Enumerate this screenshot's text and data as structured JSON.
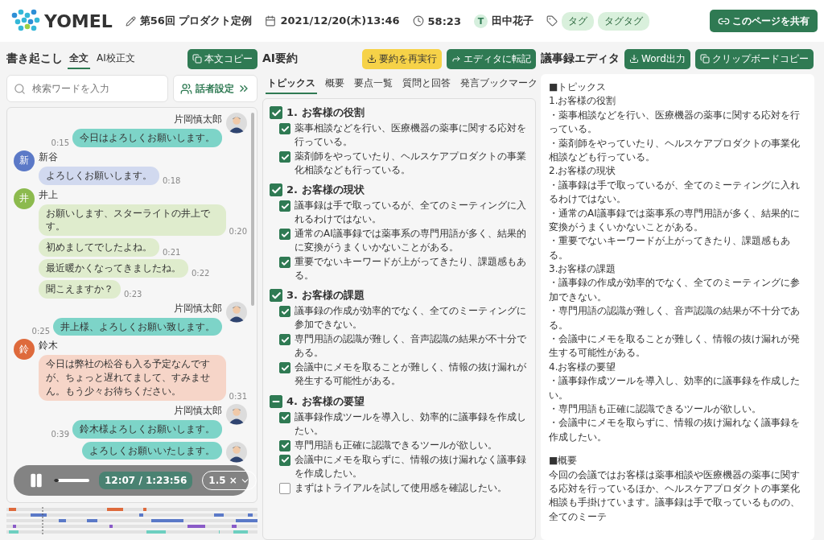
{
  "header": {
    "brand": "YOMEL",
    "meeting_title": "第56回 プロダクト定例",
    "datetime": "2021/12/20(木)13:46",
    "duration": "58:23",
    "user_initial": "T",
    "user_name": "田中花子",
    "tags": [
      "タグ",
      "タグタグ"
    ],
    "share_button": "このページを共有"
  },
  "transcript": {
    "title": "書き起こし",
    "tabs": [
      {
        "label": "全文",
        "selected": true
      },
      {
        "label": "AI校正文",
        "selected": false
      }
    ],
    "copy_button": "本文コピー",
    "search": {
      "placeholder": "検索ワードを入力"
    },
    "speaker_button": "話者設定",
    "messages": [
      {
        "own": true,
        "kind": "photo",
        "name": "片岡慎太郎",
        "times": [
          "0:15"
        ],
        "texts": [
          "今日はよろしくお願いします。"
        ]
      },
      {
        "own": false,
        "kind": "initial",
        "initial": "新",
        "color": "#5b79c7",
        "name": "新谷",
        "times": [
          "0:18"
        ],
        "texts": [
          "よろしくお願いします。"
        ]
      },
      {
        "own": false,
        "kind": "initial",
        "initial": "井",
        "color": "#8cba4e",
        "name": "井上",
        "times": [
          "0:20",
          "0:21",
          "0:22",
          "0:23"
        ],
        "texts": [
          "お願いします、スターライトの井上です。",
          "初めましてでしたよね。",
          "最近暖かくなってきましたね。",
          "聞こえますか？"
        ]
      },
      {
        "own": true,
        "kind": "photo",
        "name": "片岡慎太郎",
        "times": [
          "0:25"
        ],
        "texts": [
          "井上様、よろしくお願い致します。"
        ]
      },
      {
        "own": false,
        "kind": "initial",
        "initial": "鈴",
        "color": "#de6a3c",
        "name": "鈴木",
        "times": [
          "0:31"
        ],
        "texts": [
          "今日は弊社の松谷も入る予定なんですが、ちょっと遅れてまして、すみません。もう少々お待ちください。"
        ]
      },
      {
        "own": true,
        "kind": "photo",
        "name": "片岡慎太郎",
        "times": [
          "0:39"
        ],
        "texts": [
          "鈴木様よろしくお願いします。"
        ]
      },
      {
        "own": true,
        "kind": "photo",
        "texts": [
          "よろしくお願いいたします。"
        ]
      }
    ],
    "player": {
      "playing": true,
      "level": 0.14,
      "time": "12:07 / 1:23:56",
      "speed": "1.5 ×"
    }
  },
  "summary": {
    "title": "AI要約",
    "rerun_button": "要約を再実行",
    "transfer_button": "エディタに転記",
    "tabs": [
      {
        "label": "トピックス",
        "selected": true
      },
      {
        "label": "概要",
        "selected": false
      },
      {
        "label": "要点一覧",
        "selected": false
      },
      {
        "label": "質問と回答",
        "selected": false
      },
      {
        "label": "発言ブックマーク",
        "selected": false
      }
    ],
    "topics": [
      {
        "title": "1. お客様の役割",
        "checked": true,
        "items": [
          {
            "text": "薬事相談などを行い、医療機器の薬事に関する応対を行っている。",
            "checked": true
          },
          {
            "text": "薬剤師をやっていたり、ヘルスケアプロダクトの事業化相談なども行っている。",
            "checked": true
          }
        ]
      },
      {
        "title": "2. お客様の現状",
        "checked": true,
        "items": [
          {
            "text": "議事録は手で取っているが、全てのミーティングに入れるわけではない。",
            "checked": true
          },
          {
            "text": "通常のAI議事録では薬事系の専門用語が多く、結果的に変換がうまくいかないことがある。",
            "checked": true
          },
          {
            "text": "重要でないキーワードが上がってきたり、課題感もある。",
            "checked": true
          }
        ]
      },
      {
        "title": "3. お客様の課題",
        "checked": true,
        "items": [
          {
            "text": "議事録の作成が効率的でなく、全てのミーティングに参加できない。",
            "checked": true
          },
          {
            "text": "専門用語の認識が難しく、音声認識の結果が不十分である。",
            "checked": true
          },
          {
            "text": "会議中にメモを取ることが難しく、情報の抜け漏れが発生する可能性がある。",
            "checked": true
          }
        ]
      },
      {
        "title": "4. お客様の要望",
        "mixed": true,
        "items": [
          {
            "text": "議事録作成ツールを導入し、効率的に議事録を作成したい。",
            "checked": true
          },
          {
            "text": "専門用語も正確に認識できるツールが欲しい。",
            "checked": true
          },
          {
            "text": "会議中にメモを取らずに、情報の抜け漏れなく議事録を作成したい。",
            "checked": true
          },
          {
            "text": "まずはトライアルを試して使用感を確認したい。",
            "checked": false
          }
        ]
      }
    ]
  },
  "editor": {
    "title": "議事録エディタ",
    "word_button": "Word出力",
    "clipboard_button": "クリップボードコピー",
    "sections": [
      {
        "lines": [
          "■トピックス",
          "1.お客様の役割",
          "・薬事相談などを行い、医療機器の薬事に関する応対を行っている。",
          "・薬剤師をやっていたり、ヘルスケアプロダクトの事業化相談なども行っている。",
          "2.お客様の現状",
          "・議事録は手で取っているが、全てのミーティングに入れるわけではない。",
          "・通常のAI議事録では薬事系の専門用語が多く、結果的に変換がうまくいかないことがある。",
          "・重要でないキーワードが上がってきたり、課題感もある。",
          "3.お客様の課題",
          "・議事録の作成が効率的でなく、全てのミーティングに参加できない。",
          "・専門用語の認識が難しく、音声認識の結果が不十分である。",
          "・会議中にメモを取ることが難しく、情報の抜け漏れが発生する可能性がある。",
          "4.お客様の要望",
          "・議事録作成ツールを導入し、効率的に議事録を作成したい。",
          "・専門用語も正確に認識できるツールが欲しい。",
          "・会議中にメモを取らずに、情報の抜け漏れなく議事録を作成したい。"
        ]
      },
      {
        "lines": [
          "■概要",
          "今回の会議ではお客様は薬事相談や医療機器の薬事に関する応対を行っているほか、ヘルスケアプロダクトの事業化相談も手掛けています。議事録は手で取っているものの、全てのミーテ"
        ]
      }
    ]
  }
}
